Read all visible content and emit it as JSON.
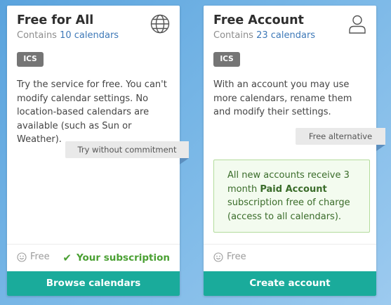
{
  "cards": [
    {
      "title": "Free for All",
      "contains_prefix": "Contains ",
      "contains_link": "10 calendars",
      "icon": "globe-icon",
      "format_badge": "ICS",
      "description": "Try the service for free. You can't modify calendar settings. No location-based calendars are available (such as Sun or Weather).",
      "ribbon": "Try without commitment",
      "price": "Free",
      "status": "Your subscription",
      "action": "Browse calendars"
    },
    {
      "title": "Free Account",
      "contains_prefix": "Contains ",
      "contains_link": "23 calendars",
      "icon": "user-icon",
      "format_badge": "ICS",
      "description": "With an account you may use more calendars, rename them and modify their settings.",
      "ribbon": "Free alternative",
      "info_pre": "All new accounts receive 3 month ",
      "info_bold": "Paid Account",
      "info_post": " subscription free of charge (access to all calendars).",
      "price": "Free",
      "action": "Create account"
    }
  ],
  "colors": {
    "accent": "#1aab9b",
    "success": "#4aa033",
    "link": "#3e79b8",
    "badge": "#757575"
  }
}
